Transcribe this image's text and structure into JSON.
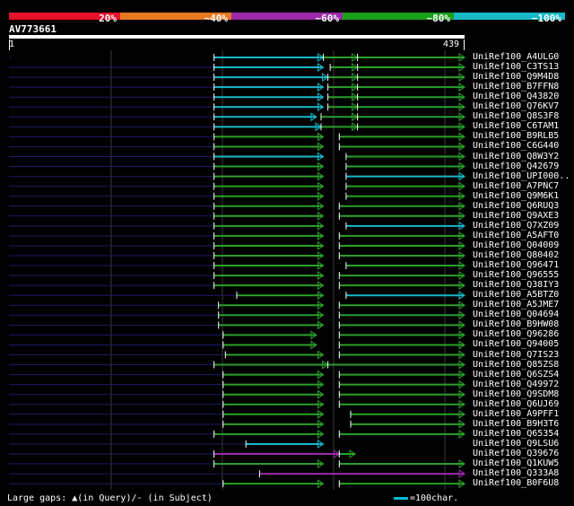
{
  "legend": {
    "labels": [
      "20%",
      "~40%",
      "~60%",
      "~80%",
      "~100%"
    ],
    "colors": [
      "#e8102a",
      "#e87820",
      "#9a2aa8",
      "#1aa01a",
      "#18b8c8"
    ]
  },
  "query": {
    "name": "AV773661",
    "start": "1",
    "end": "439",
    "length": 439
  },
  "hits": [
    {
      "label": "UniRef100_A4ULG0",
      "segs": [
        [
          0,
          1,
          "navy"
        ],
        [
          90,
          138,
          "cyan"
        ],
        [
          138,
          153,
          "green"
        ],
        [
          153,
          200,
          "green"
        ]
      ]
    },
    {
      "label": "UniRef100_C3TS13",
      "segs": [
        [
          0,
          90,
          "navy"
        ],
        [
          90,
          138,
          "cyan"
        ],
        [
          141,
          153,
          "green"
        ],
        [
          153,
          200,
          "green"
        ]
      ]
    },
    {
      "label": "UniRef100_Q9M4D8",
      "segs": [
        [
          0,
          90,
          "navy"
        ],
        [
          90,
          140,
          "cyan"
        ],
        [
          140,
          153,
          "green"
        ],
        [
          153,
          200,
          "green"
        ]
      ]
    },
    {
      "label": "UniRef100_B7FFN8",
      "segs": [
        [
          0,
          90,
          "navy"
        ],
        [
          90,
          138,
          "cyan"
        ],
        [
          140,
          153,
          "green"
        ],
        [
          153,
          200,
          "green"
        ]
      ]
    },
    {
      "label": "UniRef100_Q43820",
      "segs": [
        [
          0,
          90,
          "navy"
        ],
        [
          90,
          138,
          "cyan"
        ],
        [
          140,
          153,
          "green"
        ],
        [
          153,
          200,
          "green"
        ]
      ]
    },
    {
      "label": "UniRef100_Q76KV7",
      "segs": [
        [
          0,
          90,
          "navy"
        ],
        [
          90,
          138,
          "cyan"
        ],
        [
          140,
          153,
          "green"
        ],
        [
          153,
          200,
          "green"
        ]
      ]
    },
    {
      "label": "UniRef100_Q8S3F8",
      "segs": [
        [
          0,
          90,
          "navy"
        ],
        [
          90,
          135,
          "cyan"
        ],
        [
          137,
          153,
          "green"
        ],
        [
          153,
          200,
          "green"
        ]
      ]
    },
    {
      "label": "UniRef100_C6TAM1",
      "segs": [
        [
          0,
          90,
          "navy"
        ],
        [
          90,
          137,
          "cyan"
        ],
        [
          137,
          153,
          "green"
        ],
        [
          153,
          200,
          "green"
        ]
      ]
    },
    {
      "label": "UniRef100_B9RLB5",
      "segs": [
        [
          0,
          90,
          "navy"
        ],
        [
          90,
          138,
          "green"
        ],
        [
          145,
          200,
          "green"
        ]
      ]
    },
    {
      "label": "UniRef100_C6G440",
      "segs": [
        [
          0,
          90,
          "navy"
        ],
        [
          90,
          138,
          "green"
        ],
        [
          145,
          200,
          "green"
        ]
      ]
    },
    {
      "label": "UniRef100_Q8W3Y2",
      "segs": [
        [
          0,
          90,
          "navy"
        ],
        [
          90,
          138,
          "cyan"
        ],
        [
          148,
          200,
          "green"
        ]
      ]
    },
    {
      "label": "UniRef100_Q42679",
      "segs": [
        [
          0,
          90,
          "navy"
        ],
        [
          90,
          138,
          "green"
        ],
        [
          148,
          200,
          "green"
        ]
      ]
    },
    {
      "label": "UniRef100_UPI000..",
      "segs": [
        [
          0,
          90,
          "navy"
        ],
        [
          90,
          138,
          "green"
        ],
        [
          148,
          200,
          "cyan"
        ]
      ]
    },
    {
      "label": "UniRef100_A7PNC7",
      "segs": [
        [
          0,
          90,
          "navy"
        ],
        [
          90,
          138,
          "green"
        ],
        [
          148,
          200,
          "green"
        ]
      ]
    },
    {
      "label": "UniRef100_Q9M6K1",
      "segs": [
        [
          0,
          90,
          "navy"
        ],
        [
          90,
          138,
          "green"
        ],
        [
          148,
          200,
          "green"
        ]
      ]
    },
    {
      "label": "UniRef100_Q6RUQ3",
      "segs": [
        [
          0,
          90,
          "navy"
        ],
        [
          90,
          138,
          "green"
        ],
        [
          145,
          200,
          "green"
        ]
      ]
    },
    {
      "label": "UniRef100_Q9AXE3",
      "segs": [
        [
          0,
          90,
          "navy"
        ],
        [
          90,
          138,
          "green"
        ],
        [
          145,
          200,
          "green"
        ]
      ]
    },
    {
      "label": "UniRef100_Q7XZ09",
      "segs": [
        [
          0,
          90,
          "navy"
        ],
        [
          90,
          138,
          "green"
        ],
        [
          148,
          200,
          "cyan"
        ]
      ]
    },
    {
      "label": "UniRef100_A5AFT0",
      "segs": [
        [
          0,
          90,
          "navy"
        ],
        [
          90,
          138,
          "green"
        ],
        [
          145,
          200,
          "green"
        ]
      ]
    },
    {
      "label": "UniRef100_Q04009",
      "segs": [
        [
          0,
          90,
          "navy"
        ],
        [
          90,
          138,
          "green"
        ],
        [
          145,
          200,
          "green"
        ]
      ]
    },
    {
      "label": "UniRef100_Q80402",
      "segs": [
        [
          0,
          90,
          "navy"
        ],
        [
          90,
          138,
          "green"
        ],
        [
          145,
          200,
          "green"
        ]
      ]
    },
    {
      "label": "UniRef100_Q96471",
      "segs": [
        [
          0,
          90,
          "navy"
        ],
        [
          90,
          138,
          "green"
        ],
        [
          148,
          200,
          "green"
        ]
      ]
    },
    {
      "label": "UniRef100_Q96555",
      "segs": [
        [
          0,
          90,
          "navy"
        ],
        [
          90,
          138,
          "green"
        ],
        [
          145,
          200,
          "green"
        ]
      ]
    },
    {
      "label": "UniRef100_Q38IY3",
      "segs": [
        [
          0,
          90,
          "navy"
        ],
        [
          90,
          138,
          "green"
        ],
        [
          145,
          200,
          "green"
        ]
      ]
    },
    {
      "label": "UniRef100_A5BTZ0",
      "segs": [
        [
          0,
          100,
          "navy"
        ],
        [
          100,
          138,
          "green"
        ],
        [
          148,
          200,
          "cyan"
        ]
      ]
    },
    {
      "label": "UniRef100_A5JME7",
      "segs": [
        [
          0,
          92,
          "navy"
        ],
        [
          92,
          138,
          "green"
        ],
        [
          145,
          200,
          "green"
        ]
      ]
    },
    {
      "label": "UniRef100_Q04694",
      "segs": [
        [
          0,
          92,
          "navy"
        ],
        [
          92,
          138,
          "green"
        ],
        [
          145,
          200,
          "green"
        ]
      ]
    },
    {
      "label": "UniRef100_B9HW08",
      "segs": [
        [
          0,
          92,
          "navy"
        ],
        [
          92,
          138,
          "green"
        ],
        [
          145,
          200,
          "green"
        ]
      ]
    },
    {
      "label": "UniRef100_Q96286",
      "segs": [
        [
          0,
          94,
          "navy"
        ],
        [
          94,
          135,
          "green"
        ],
        [
          145,
          200,
          "green"
        ]
      ]
    },
    {
      "label": "UniRef100_Q94005",
      "segs": [
        [
          0,
          94,
          "navy"
        ],
        [
          94,
          135,
          "green"
        ],
        [
          145,
          200,
          "green"
        ]
      ]
    },
    {
      "label": "UniRef100_Q7IS23",
      "segs": [
        [
          0,
          95,
          "navy"
        ],
        [
          95,
          138,
          "green"
        ],
        [
          145,
          200,
          "green"
        ]
      ]
    },
    {
      "label": "UniRef100_Q85ZS8",
      "segs": [
        [
          0,
          90,
          "navy"
        ],
        [
          90,
          140,
          "green"
        ],
        [
          140,
          200,
          "green"
        ]
      ]
    },
    {
      "label": "UniRef100_Q6SZS4",
      "segs": [
        [
          0,
          94,
          "navy"
        ],
        [
          94,
          138,
          "green"
        ],
        [
          145,
          200,
          "green"
        ]
      ]
    },
    {
      "label": "UniRef100_Q49972",
      "segs": [
        [
          0,
          94,
          "navy"
        ],
        [
          94,
          138,
          "green"
        ],
        [
          145,
          200,
          "green"
        ]
      ]
    },
    {
      "label": "UniRef100_Q9SDM8",
      "segs": [
        [
          0,
          94,
          "navy"
        ],
        [
          94,
          138,
          "green"
        ],
        [
          145,
          200,
          "green"
        ]
      ]
    },
    {
      "label": "UniRef100_Q6UJ69",
      "segs": [
        [
          0,
          94,
          "navy"
        ],
        [
          94,
          138,
          "green"
        ],
        [
          145,
          200,
          "green"
        ]
      ]
    },
    {
      "label": "UniRef100_A9PFF1",
      "segs": [
        [
          0,
          94,
          "navy"
        ],
        [
          94,
          138,
          "green"
        ],
        [
          150,
          200,
          "green"
        ]
      ]
    },
    {
      "label": "UniRef100_B9H3T6",
      "segs": [
        [
          0,
          94,
          "navy"
        ],
        [
          94,
          138,
          "green"
        ],
        [
          150,
          200,
          "green"
        ]
      ]
    },
    {
      "label": "UniRef100_Q65354",
      "segs": [
        [
          0,
          90,
          "navy"
        ],
        [
          90,
          138,
          "green"
        ],
        [
          145,
          200,
          "green"
        ]
      ]
    },
    {
      "label": "UniRef100_Q9LSU6",
      "segs": [
        [
          0,
          104,
          "navy"
        ],
        [
          104,
          138,
          "cyan"
        ]
      ]
    },
    {
      "label": "UniRef100_Q39676",
      "segs": [
        [
          0,
          90,
          "navy"
        ],
        [
          90,
          145,
          "magenta"
        ],
        [
          145,
          152,
          "green"
        ]
      ]
    },
    {
      "label": "UniRef100_Q1KUW5",
      "segs": [
        [
          0,
          90,
          "navy"
        ],
        [
          90,
          138,
          "green"
        ],
        [
          145,
          200,
          "green"
        ]
      ]
    },
    {
      "label": "UniRef100_Q333A8",
      "segs": [
        [
          0,
          110,
          "navy"
        ],
        [
          110,
          200,
          "magenta"
        ]
      ]
    },
    {
      "label": "UniRef100_B0F6U8",
      "segs": [
        [
          0,
          94,
          "navy"
        ],
        [
          94,
          138,
          "green"
        ],
        [
          145,
          200,
          "green"
        ]
      ]
    }
  ],
  "footer": {
    "gaps_text": "Large gaps: ▲(in Query)/- (in Subject)",
    "scale_text": "=100char."
  },
  "colors": {
    "navy": "#1a1a6a",
    "green": "#2aa02a",
    "cyan": "#18b8c8",
    "magenta": "#9a2aa8",
    "grid": "#3a3a3a"
  }
}
